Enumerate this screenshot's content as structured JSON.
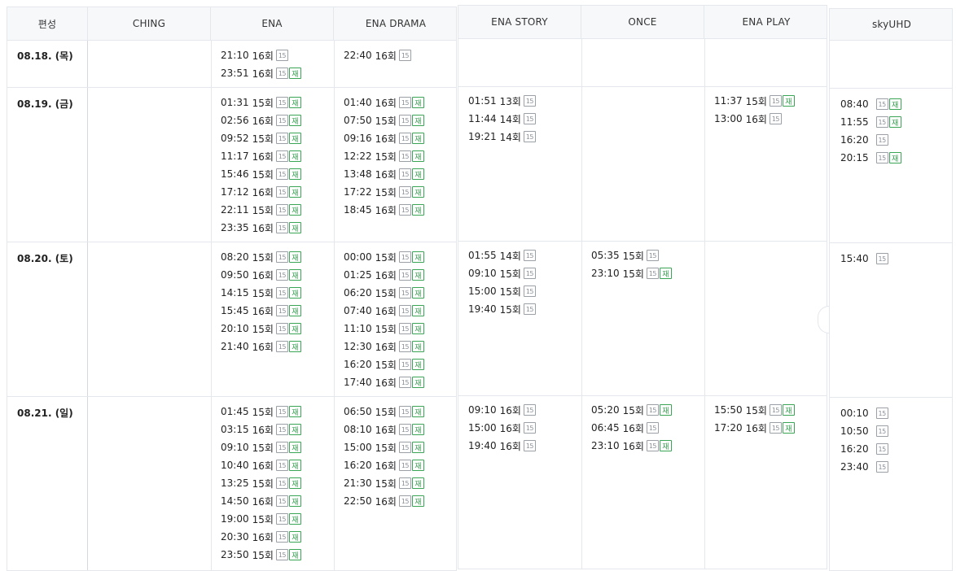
{
  "header": {
    "col0": "편성",
    "channels": [
      "CHING",
      "ENA",
      "ENA DRAMA",
      "ENA STORY",
      "ONCE",
      "ENA PLAY",
      "skyUHD"
    ]
  },
  "labels": {
    "rating": "15",
    "rerun": "재",
    "episode_suffix": "회"
  },
  "rows": [
    {
      "date": "08.18. (목)",
      "ching": [],
      "ena": [
        {
          "time": "21:10",
          "ep": "16회",
          "re": false
        },
        {
          "time": "23:51",
          "ep": "16회",
          "re": true
        }
      ],
      "ena_drama": [
        {
          "time": "22:40",
          "ep": "16회",
          "re": false
        }
      ],
      "ena_story": [],
      "once": [],
      "ena_play": [],
      "skyuhd": []
    },
    {
      "date": "08.19. (금)",
      "ching": [],
      "ena": [
        {
          "time": "01:31",
          "ep": "15회",
          "re": true
        },
        {
          "time": "02:56",
          "ep": "16회",
          "re": true
        },
        {
          "time": "09:52",
          "ep": "15회",
          "re": true
        },
        {
          "time": "11:17",
          "ep": "16회",
          "re": true
        },
        {
          "time": "15:46",
          "ep": "15회",
          "re": true
        },
        {
          "time": "17:12",
          "ep": "16회",
          "re": true
        },
        {
          "time": "22:11",
          "ep": "15회",
          "re": true
        },
        {
          "time": "23:35",
          "ep": "16회",
          "re": true
        }
      ],
      "ena_drama": [
        {
          "time": "01:40",
          "ep": "16회",
          "re": true
        },
        {
          "time": "07:50",
          "ep": "15회",
          "re": true
        },
        {
          "time": "09:16",
          "ep": "16회",
          "re": true
        },
        {
          "time": "12:22",
          "ep": "15회",
          "re": true
        },
        {
          "time": "13:48",
          "ep": "16회",
          "re": true
        },
        {
          "time": "17:22",
          "ep": "15회",
          "re": true
        },
        {
          "time": "18:45",
          "ep": "16회",
          "re": true
        }
      ],
      "ena_story": [
        {
          "time": "01:51",
          "ep": "13회",
          "re": false
        },
        {
          "time": "11:44",
          "ep": "14회",
          "re": false
        },
        {
          "time": "19:21",
          "ep": "14회",
          "re": false
        }
      ],
      "once": [],
      "ena_play": [
        {
          "time": "11:37",
          "ep": "15회",
          "re": true
        },
        {
          "time": "13:00",
          "ep": "16회",
          "re": false
        }
      ],
      "skyuhd": [
        {
          "time": "08:40",
          "ep": "",
          "re": true
        },
        {
          "time": "11:55",
          "ep": "",
          "re": true
        },
        {
          "time": "16:20",
          "ep": "",
          "re": false
        },
        {
          "time": "20:15",
          "ep": "",
          "re": true
        }
      ]
    },
    {
      "date": "08.20. (토)",
      "ching": [],
      "ena": [
        {
          "time": "08:20",
          "ep": "15회",
          "re": true
        },
        {
          "time": "09:50",
          "ep": "16회",
          "re": true
        },
        {
          "time": "14:15",
          "ep": "15회",
          "re": true
        },
        {
          "time": "15:45",
          "ep": "16회",
          "re": true
        },
        {
          "time": "20:10",
          "ep": "15회",
          "re": true
        },
        {
          "time": "21:40",
          "ep": "16회",
          "re": true
        }
      ],
      "ena_drama": [
        {
          "time": "00:00",
          "ep": "15회",
          "re": true
        },
        {
          "time": "01:25",
          "ep": "16회",
          "re": true
        },
        {
          "time": "06:20",
          "ep": "15회",
          "re": true
        },
        {
          "time": "07:40",
          "ep": "16회",
          "re": true
        },
        {
          "time": "11:10",
          "ep": "15회",
          "re": true
        },
        {
          "time": "12:30",
          "ep": "16회",
          "re": true
        },
        {
          "time": "16:20",
          "ep": "15회",
          "re": true
        },
        {
          "time": "17:40",
          "ep": "16회",
          "re": true
        }
      ],
      "ena_story": [
        {
          "time": "01:55",
          "ep": "14회",
          "re": false
        },
        {
          "time": "09:10",
          "ep": "15회",
          "re": false
        },
        {
          "time": "15:00",
          "ep": "15회",
          "re": false
        },
        {
          "time": "19:40",
          "ep": "15회",
          "re": false
        }
      ],
      "once": [
        {
          "time": "05:35",
          "ep": "15회",
          "re": false
        },
        {
          "time": "23:10",
          "ep": "15회",
          "re": true
        }
      ],
      "ena_play": [],
      "skyuhd": [
        {
          "time": "15:40",
          "ep": "",
          "re": false
        }
      ]
    },
    {
      "date": "08.21. (일)",
      "ching": [],
      "ena": [
        {
          "time": "01:45",
          "ep": "15회",
          "re": true
        },
        {
          "time": "03:15",
          "ep": "16회",
          "re": true
        },
        {
          "time": "09:10",
          "ep": "15회",
          "re": true
        },
        {
          "time": "10:40",
          "ep": "16회",
          "re": true
        },
        {
          "time": "13:25",
          "ep": "15회",
          "re": true
        },
        {
          "time": "14:50",
          "ep": "16회",
          "re": true
        },
        {
          "time": "19:00",
          "ep": "15회",
          "re": true
        },
        {
          "time": "20:30",
          "ep": "16회",
          "re": true
        },
        {
          "time": "23:50",
          "ep": "15회",
          "re": true
        }
      ],
      "ena_drama": [
        {
          "time": "06:50",
          "ep": "15회",
          "re": true
        },
        {
          "time": "08:10",
          "ep": "16회",
          "re": true
        },
        {
          "time": "15:00",
          "ep": "15회",
          "re": true
        },
        {
          "time": "16:20",
          "ep": "16회",
          "re": true
        },
        {
          "time": "21:30",
          "ep": "15회",
          "re": true
        },
        {
          "time": "22:50",
          "ep": "16회",
          "re": true
        }
      ],
      "ena_story": [
        {
          "time": "09:10",
          "ep": "16회",
          "re": false
        },
        {
          "time": "15:00",
          "ep": "16회",
          "re": false
        },
        {
          "time": "19:40",
          "ep": "16회",
          "re": false
        }
      ],
      "once": [
        {
          "time": "05:20",
          "ep": "15회",
          "re": true
        },
        {
          "time": "06:45",
          "ep": "16회",
          "re": false
        },
        {
          "time": "23:10",
          "ep": "16회",
          "re": true
        }
      ],
      "ena_play": [
        {
          "time": "15:50",
          "ep": "15회",
          "re": true
        },
        {
          "time": "17:20",
          "ep": "16회",
          "re": true
        }
      ],
      "skyuhd": [
        {
          "time": "00:10",
          "ep": "",
          "re": false
        },
        {
          "time": "10:50",
          "ep": "",
          "re": false
        },
        {
          "time": "16:20",
          "ep": "",
          "re": false
        },
        {
          "time": "23:40",
          "ep": "",
          "re": false
        }
      ]
    }
  ]
}
